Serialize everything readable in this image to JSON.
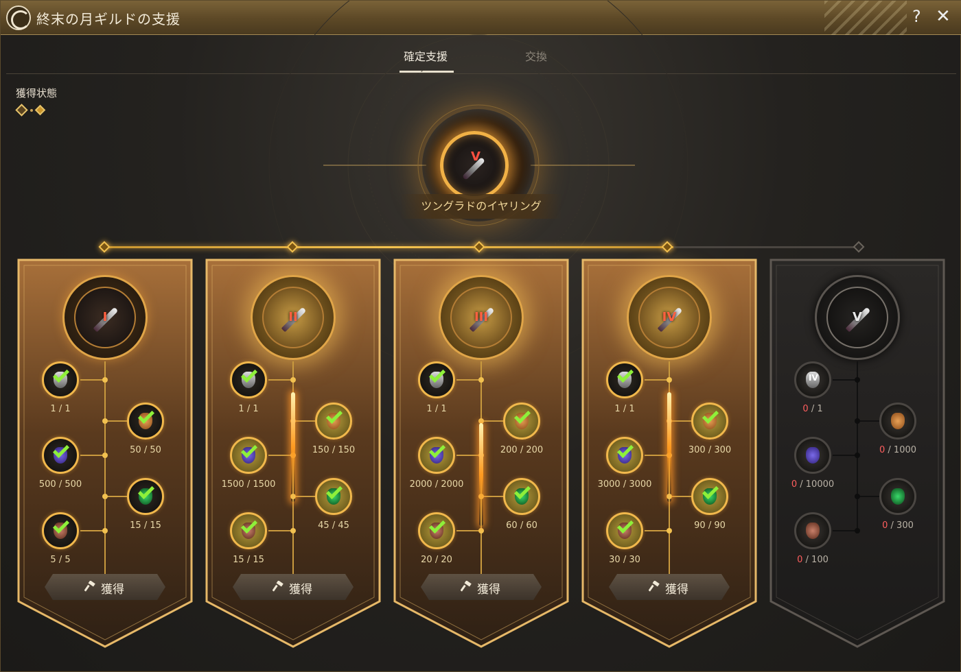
{
  "window": {
    "title": "終末の月ギルドの支援",
    "help": "?",
    "close": "✕"
  },
  "tabs": [
    {
      "label": "確定支援",
      "active": true
    },
    {
      "label": "交換",
      "active": false
    }
  ],
  "status": {
    "label": "獲得状態"
  },
  "reward": {
    "name": "ツングラドのイヤリング",
    "tier": "V"
  },
  "progress": {
    "nodes_lit": 4,
    "nodes_total": 5
  },
  "button_label": "獲得",
  "banners": [
    {
      "tier": "I",
      "state": "claimable",
      "materials": [
        {
          "icon": "earring-icon",
          "have": "1",
          "need": "1",
          "done": true
        },
        {
          "icon": "pouch-icon",
          "have": "50",
          "need": "50",
          "done": true
        },
        {
          "icon": "crystal-icon",
          "have": "500",
          "need": "500",
          "done": true
        },
        {
          "icon": "herb-icon",
          "have": "15",
          "need": "15",
          "done": true
        },
        {
          "icon": "ore-icon",
          "have": "5",
          "need": "5",
          "done": true
        }
      ]
    },
    {
      "tier": "II",
      "state": "claimable",
      "materials": [
        {
          "icon": "earring-icon",
          "have": "1",
          "need": "1",
          "done": true
        },
        {
          "icon": "pouch-icon",
          "have": "150",
          "need": "150",
          "done": true
        },
        {
          "icon": "crystal-icon",
          "have": "1500",
          "need": "1500",
          "done": true
        },
        {
          "icon": "herb-icon",
          "have": "45",
          "need": "45",
          "done": true
        },
        {
          "icon": "ore-icon",
          "have": "15",
          "need": "15",
          "done": true
        }
      ]
    },
    {
      "tier": "III",
      "state": "claimable",
      "materials": [
        {
          "icon": "earring-icon",
          "have": "1",
          "need": "1",
          "done": true
        },
        {
          "icon": "pouch-icon",
          "have": "200",
          "need": "200",
          "done": true
        },
        {
          "icon": "crystal-icon",
          "have": "2000",
          "need": "2000",
          "done": true
        },
        {
          "icon": "herb-icon",
          "have": "60",
          "need": "60",
          "done": true
        },
        {
          "icon": "ore-icon",
          "have": "20",
          "need": "20",
          "done": true
        }
      ]
    },
    {
      "tier": "IV",
      "state": "claimable",
      "materials": [
        {
          "icon": "earring-icon",
          "have": "1",
          "need": "1",
          "done": true
        },
        {
          "icon": "pouch-icon",
          "have": "300",
          "need": "300",
          "done": true
        },
        {
          "icon": "crystal-icon",
          "have": "3000",
          "need": "3000",
          "done": true
        },
        {
          "icon": "herb-icon",
          "have": "90",
          "need": "90",
          "done": true
        },
        {
          "icon": "ore-icon",
          "have": "30",
          "need": "30",
          "done": true
        }
      ]
    },
    {
      "tier": "V",
      "state": "locked",
      "materials": [
        {
          "icon": "earring-icon",
          "tier": "IV",
          "have": "0",
          "need": "1",
          "done": false
        },
        {
          "icon": "pouch-icon",
          "have": "0",
          "need": "1000",
          "done": false
        },
        {
          "icon": "crystal-icon",
          "have": "0",
          "need": "10000",
          "done": false
        },
        {
          "icon": "herb-icon",
          "have": "0",
          "need": "300",
          "done": false
        },
        {
          "icon": "ore-icon",
          "have": "0",
          "need": "100",
          "done": false
        }
      ]
    }
  ],
  "colors": {
    "gold": "#f2c150",
    "check": "#8ef03a",
    "missing": "#ff5e5e",
    "panel": "#24221f"
  }
}
